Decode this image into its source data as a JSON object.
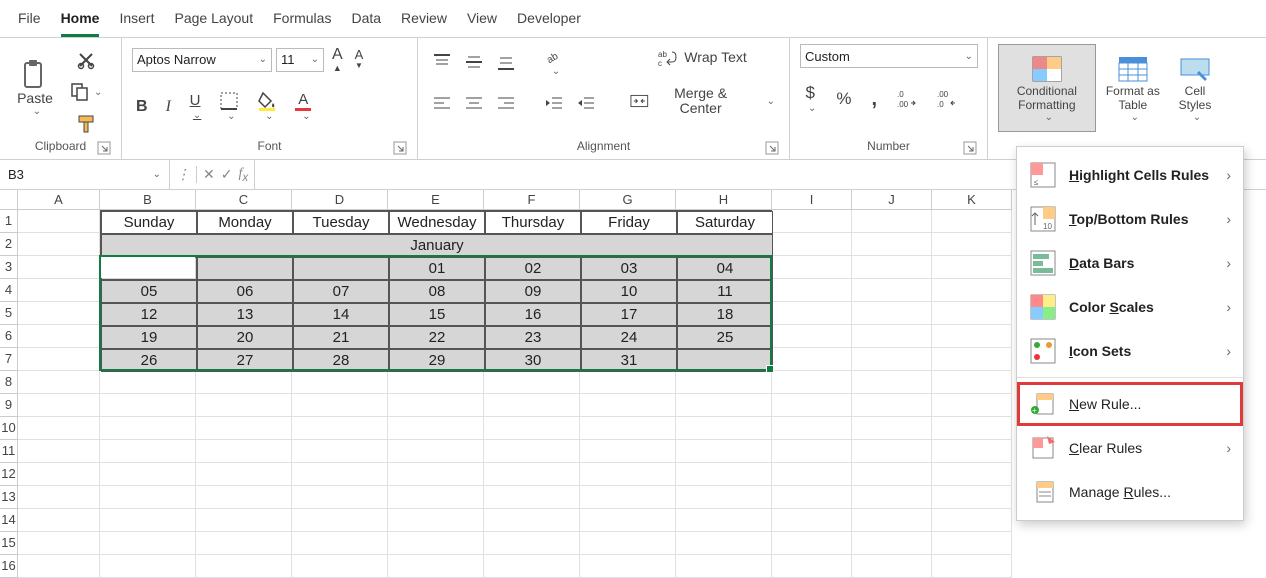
{
  "tabs": [
    "File",
    "Home",
    "Insert",
    "Page Layout",
    "Formulas",
    "Data",
    "Review",
    "View",
    "Developer"
  ],
  "active_tab": 1,
  "clipboard": {
    "paste": "Paste",
    "title": "Clipboard"
  },
  "font": {
    "title": "Font",
    "name": "Aptos Narrow",
    "size": "11"
  },
  "alignment": {
    "title": "Alignment",
    "wrap": "Wrap Text",
    "merge": "Merge & Center"
  },
  "number": {
    "title": "Number",
    "format": "Custom"
  },
  "styles": {
    "cond": "Conditional Formatting",
    "fat": "Format as Table",
    "cell": "Cell Styles"
  },
  "namebox": "B3",
  "col_widths": {
    "A": 82,
    "other": 96,
    "after": 80
  },
  "columns": [
    "A",
    "B",
    "C",
    "D",
    "E",
    "F",
    "G",
    "H",
    "I",
    "J",
    "K"
  ],
  "row_count": 16,
  "calendar": {
    "days": [
      "Sunday",
      "Monday",
      "Tuesday",
      "Wednesday",
      "Thursday",
      "Friday",
      "Saturday"
    ],
    "month": "January",
    "rows": [
      [
        "",
        "",
        "",
        "01",
        "02",
        "03",
        "04"
      ],
      [
        "05",
        "06",
        "07",
        "08",
        "09",
        "10",
        "11"
      ],
      [
        "12",
        "13",
        "14",
        "15",
        "16",
        "17",
        "18"
      ],
      [
        "19",
        "20",
        "21",
        "22",
        "23",
        "24",
        "25"
      ],
      [
        "26",
        "27",
        "28",
        "29",
        "30",
        "31",
        ""
      ]
    ]
  },
  "menu": {
    "items": [
      {
        "label": "Highlight Cells Rules",
        "sub": true,
        "u": 0,
        "bold": true
      },
      {
        "label": "Top/Bottom Rules",
        "sub": true,
        "u": 0,
        "bold": true
      },
      {
        "label": "Data Bars",
        "sub": true,
        "u": 0,
        "bold": true
      },
      {
        "label": "Color Scales",
        "sub": true,
        "u": 6,
        "bold": true
      },
      {
        "label": "Icon Sets",
        "sub": true,
        "u": 0,
        "bold": true
      }
    ],
    "items2": [
      {
        "label": "New Rule...",
        "u": 0,
        "highlighted": true
      },
      {
        "label": "Clear Rules",
        "u": 0,
        "sub": true
      },
      {
        "label": "Manage Rules...",
        "u": 7
      }
    ]
  }
}
